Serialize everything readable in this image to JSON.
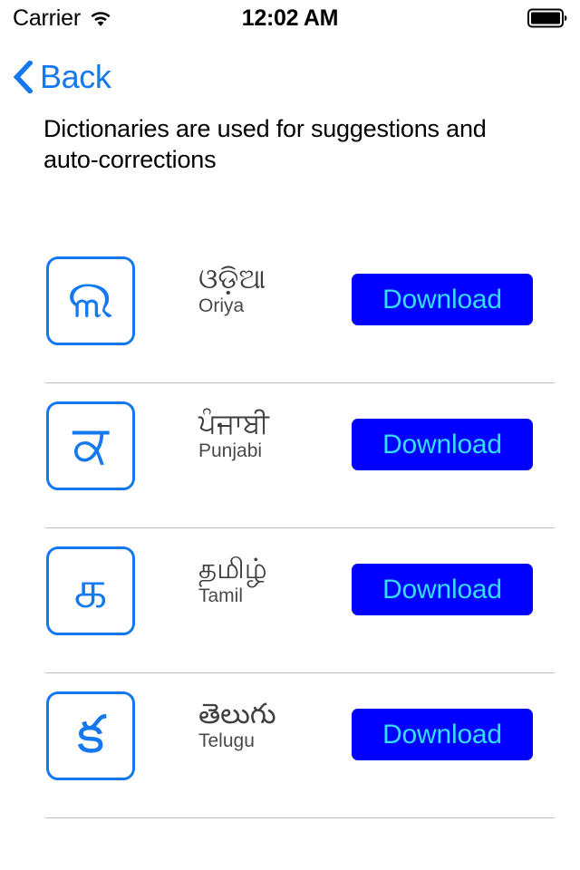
{
  "status_bar": {
    "carrier": "Carrier",
    "wifi_icon": "wifi-icon",
    "time": "12:02 AM",
    "battery_icon": "battery-full-icon"
  },
  "nav_bar": {
    "back_label": "Back",
    "back_icon": "chevron-left-icon"
  },
  "description": "Dictionaries are used for suggestions and auto-corrections",
  "colors": {
    "tint": "#1478F0",
    "button_background": "#0000FF",
    "button_text": "#33DDFF",
    "separator": "#BFBFBF",
    "text": "#3E3E3E"
  },
  "languages": [
    {
      "glyph": "ଲ",
      "native": "ଓଡ଼ିଆ",
      "english": "Oriya",
      "action": "Download"
    },
    {
      "glyph": "ਕ",
      "native": "ਪੰਜਾਬੀ",
      "english": "Punjabi",
      "action": "Download"
    },
    {
      "glyph": "க",
      "native": "தமிழ்",
      "english": "Tamil",
      "action": "Download"
    },
    {
      "glyph": "క",
      "native": "తెలుగు",
      "english": "Telugu",
      "action": "Download"
    }
  ]
}
